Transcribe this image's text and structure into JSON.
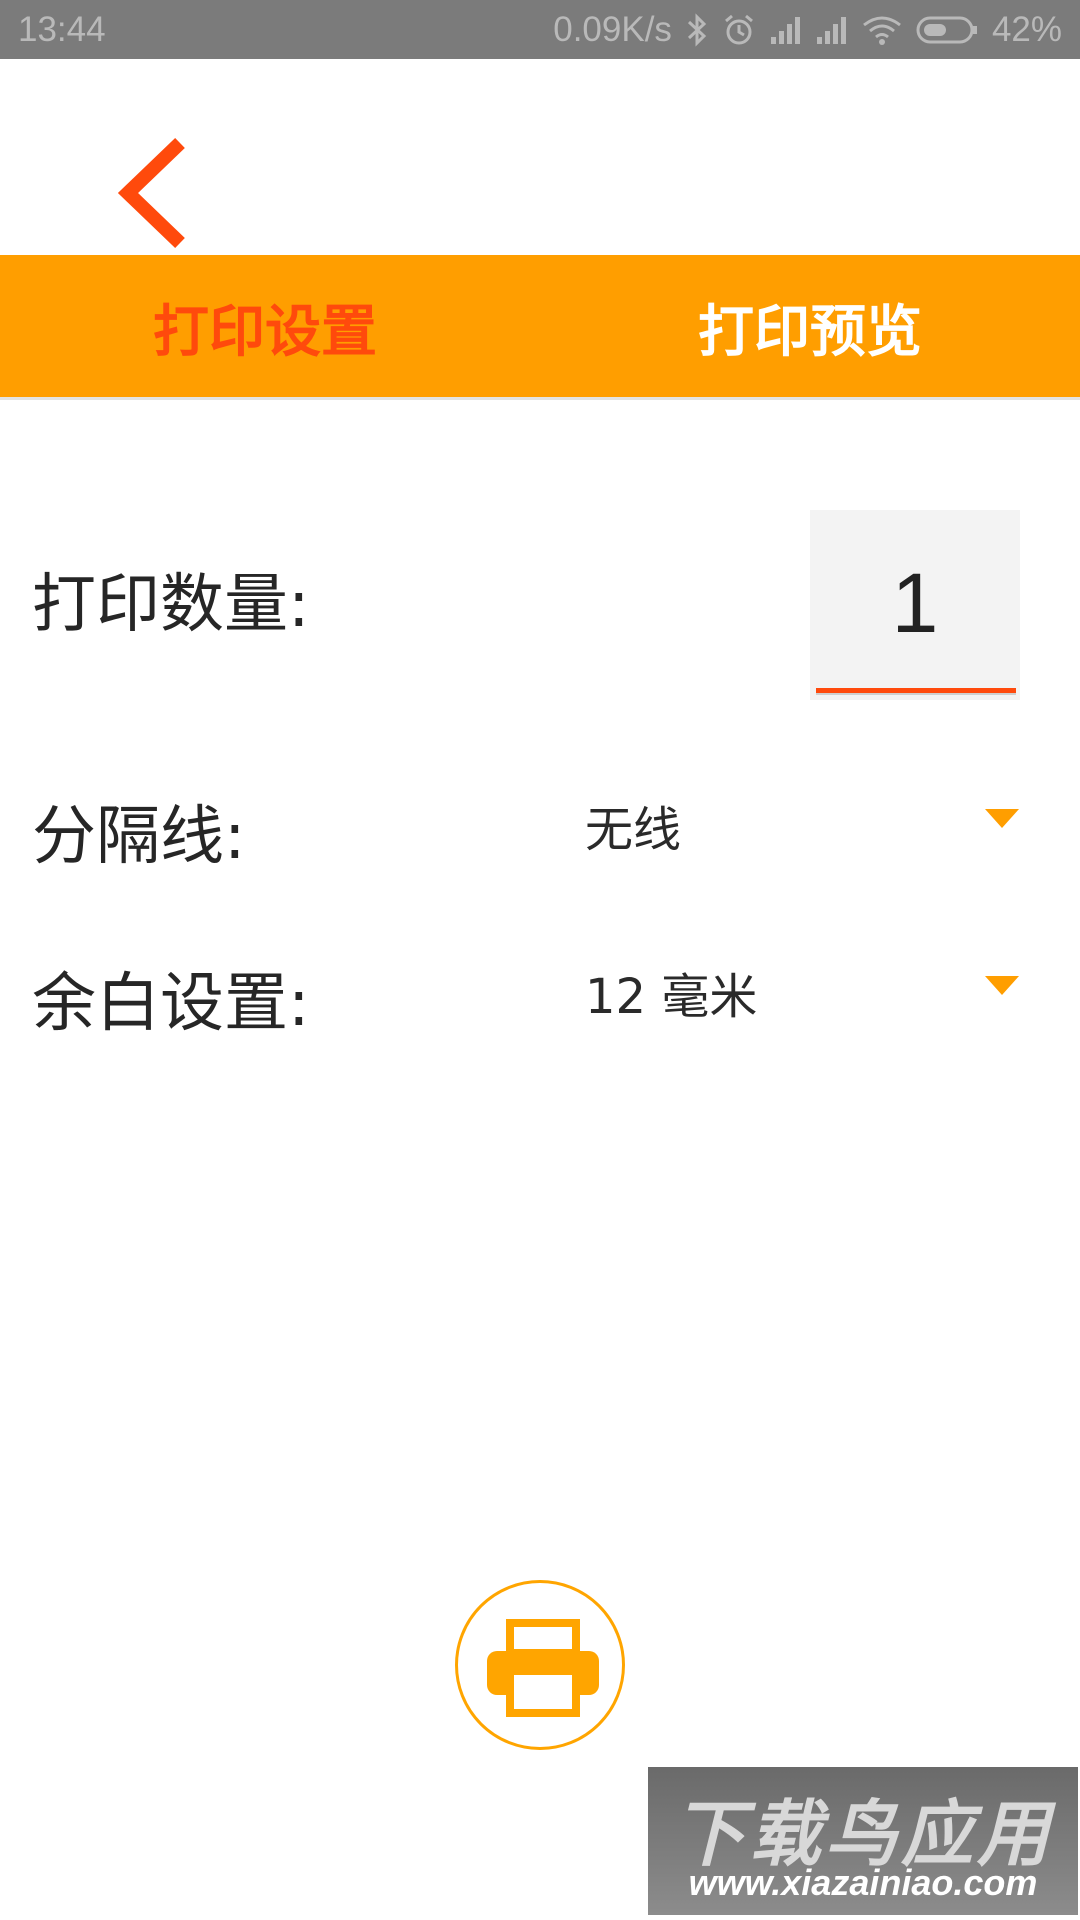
{
  "status_bar": {
    "time": "13:44",
    "speed": "0.09K/s",
    "battery": "42%",
    "icons": [
      "bluetooth-icon",
      "alarm-icon",
      "signal-icon",
      "signal-icon",
      "wifi-icon",
      "battery-icon"
    ]
  },
  "nav": {
    "back_icon": "chevron-left-icon"
  },
  "tabs": [
    {
      "label": "打印设置",
      "active": true
    },
    {
      "label": "打印预览",
      "active": false
    }
  ],
  "settings": {
    "quantity_label": "打印数量:",
    "quantity_value": "1",
    "divider_label": "分隔线:",
    "divider_value": "无线",
    "margin_label": "余白设置:",
    "margin_value": "12 毫米"
  },
  "print_button": {
    "icon": "printer-icon"
  },
  "watermark": {
    "title": "下载鸟应用",
    "url": "www.xiazainiao.com"
  },
  "colors": {
    "accent": "#ff9e00",
    "active_tab": "#ff4a0c",
    "status_bar": "#7b7b7b"
  }
}
